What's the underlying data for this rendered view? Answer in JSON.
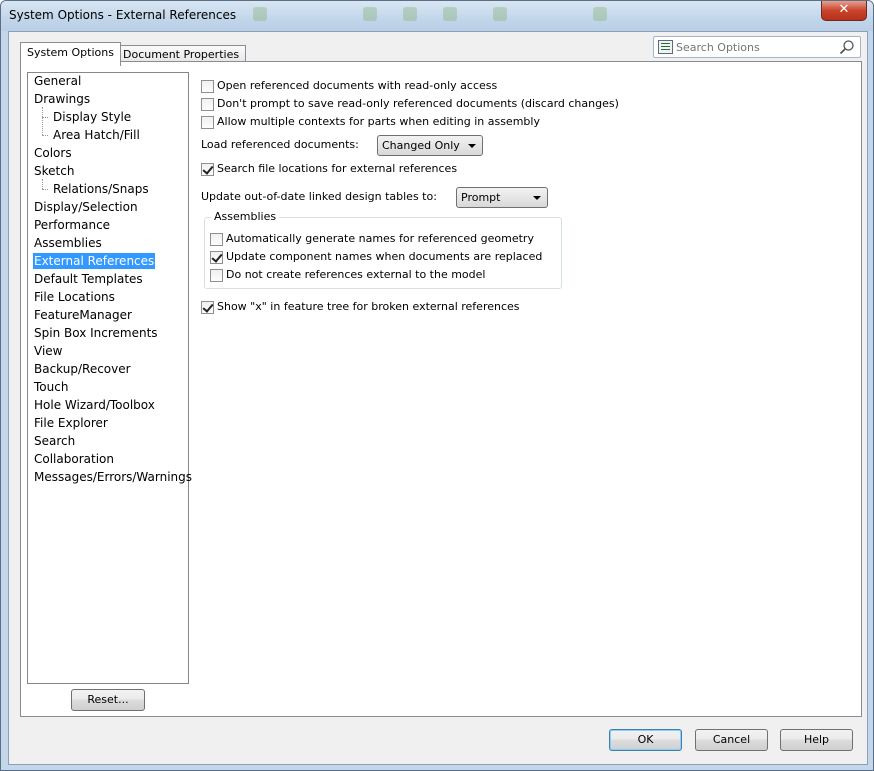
{
  "window": {
    "title": "System Options - External References",
    "close_glyph": "✕"
  },
  "tabs": [
    {
      "label": "System Options",
      "active": true
    },
    {
      "label": "Document Properties",
      "active": false
    }
  ],
  "search": {
    "placeholder": "Search Options",
    "icon": "search-icon"
  },
  "tree": {
    "items": [
      {
        "label": "General",
        "level": 0
      },
      {
        "label": "Drawings",
        "level": 0
      },
      {
        "label": "Display Style",
        "level": 1
      },
      {
        "label": "Area Hatch/Fill",
        "level": 1
      },
      {
        "label": "Colors",
        "level": 0
      },
      {
        "label": "Sketch",
        "level": 0
      },
      {
        "label": "Relations/Snaps",
        "level": 1
      },
      {
        "label": "Display/Selection",
        "level": 0
      },
      {
        "label": "Performance",
        "level": 0
      },
      {
        "label": "Assemblies",
        "level": 0
      },
      {
        "label": "External References",
        "level": 0,
        "selected": true
      },
      {
        "label": "Default Templates",
        "level": 0
      },
      {
        "label": "File Locations",
        "level": 0
      },
      {
        "label": "FeatureManager",
        "level": 0
      },
      {
        "label": "Spin Box Increments",
        "level": 0
      },
      {
        "label": "View",
        "level": 0
      },
      {
        "label": "Backup/Recover",
        "level": 0
      },
      {
        "label": "Touch",
        "level": 0
      },
      {
        "label": "Hole Wizard/Toolbox",
        "level": 0
      },
      {
        "label": "File Explorer",
        "level": 0
      },
      {
        "label": "Search",
        "level": 0
      },
      {
        "label": "Collaboration",
        "level": 0
      },
      {
        "label": "Messages/Errors/Warnings",
        "level": 0
      }
    ],
    "reset_label": "Reset..."
  },
  "options": {
    "open_readonly": {
      "label": "Open referenced documents with read-only access",
      "checked": false
    },
    "dont_prompt_save": {
      "label": "Don't prompt to save read-only referenced documents (discard changes)",
      "checked": false
    },
    "allow_multiple_contexts": {
      "label": "Allow multiple contexts for parts when editing in assembly",
      "checked": false
    },
    "load_referenced_label": "Load referenced documents:",
    "load_referenced_value": "Changed Only",
    "search_file_locations": {
      "label": "Search file locations for external references",
      "checked": true
    },
    "update_tables_label": "Update out-of-date linked design tables to:",
    "update_tables_value": "Prompt",
    "assemblies_group_title": "Assemblies",
    "auto_generate_names": {
      "label": "Automatically generate names for referenced geometry",
      "checked": false
    },
    "update_component_names": {
      "label": "Update component names when documents are replaced",
      "checked": true
    },
    "no_external_refs": {
      "label": "Do not create references external to the model",
      "checked": false
    },
    "show_x_broken": {
      "label": "Show \"x\" in feature tree for broken external references",
      "checked": true
    }
  },
  "footer": {
    "ok_label": "OK",
    "cancel_label": "Cancel",
    "help_label": "Help"
  }
}
